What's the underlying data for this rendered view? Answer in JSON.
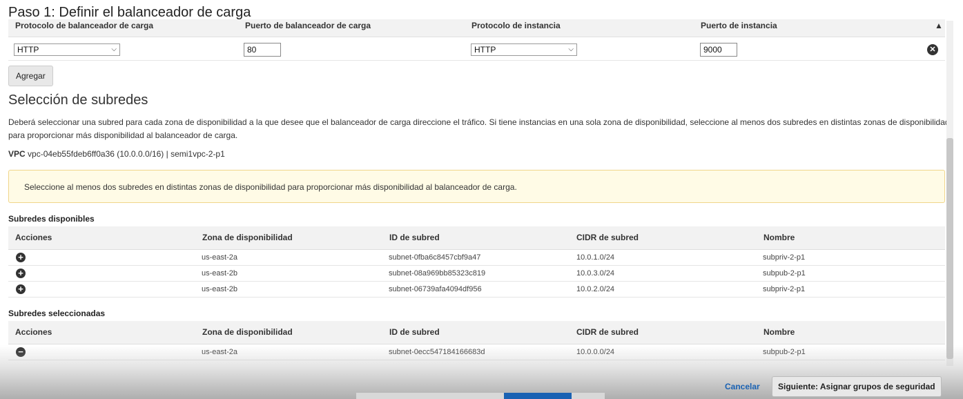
{
  "step_title": "Paso 1: Definir el balanceador de carga",
  "listeners": {
    "headers": [
      "Protocolo de balanceador de carga",
      "Puerto de balanceador de carga",
      "Protocolo de instancia",
      "Puerto de instancia"
    ],
    "row": {
      "lb_protocol": "HTTP",
      "lb_port": "80",
      "instance_protocol": "HTTP",
      "instance_port": "9000"
    },
    "add_label": "Agregar"
  },
  "subnets": {
    "title": "Selección de subredes",
    "description": "Deberá seleccionar una subred para cada zona de disponibilidad a la que desee que el balanceador de carga direccione el tráfico. Si tiene instancias en una sola zona de disponibilidad, seleccione al menos dos subredes en distintas zonas de disponibilidad para proporcionar más disponibilidad al balanceador de carga.",
    "vpc_label": "VPC",
    "vpc_value": "vpc-04eb55fdeb6ff0a36 (10.0.0.0/16) | semi1vpc-2-p1",
    "warning": "Seleccione al menos dos subredes en distintas zonas de disponibilidad para proporcionar más disponibilidad al balanceador de carga.",
    "available_label": "Subredes disponibles",
    "selected_label": "Subredes seleccionadas",
    "columns": [
      "Acciones",
      "Zona de disponibilidad",
      "ID de subred",
      "CIDR de subred",
      "Nombre"
    ],
    "available": [
      {
        "zone": "us-east-2a",
        "id": "subnet-0fba6c8457cbf9a47",
        "cidr": "10.0.1.0/24",
        "name": "subpriv-2-p1"
      },
      {
        "zone": "us-east-2b",
        "id": "subnet-08a969bb85323c819",
        "cidr": "10.0.3.0/24",
        "name": "subpub-2-p1"
      },
      {
        "zone": "us-east-2b",
        "id": "subnet-06739afa4094df956",
        "cidr": "10.0.2.0/24",
        "name": "subpriv-2-p1"
      }
    ],
    "selected": [
      {
        "zone": "us-east-2a",
        "id": "subnet-0ecc547184166683d",
        "cidr": "10.0.0.0/24",
        "name": "subpub-2-p1"
      }
    ]
  },
  "footer": {
    "cancel": "Cancelar",
    "next": "Siguiente: Asignar grupos de seguridad"
  },
  "icons": {
    "add": "plus-circle-icon",
    "remove": "minus-circle-icon",
    "delete": "close-circle-icon"
  },
  "colors": {
    "link": "#1a62b3",
    "warning_bg": "#fffbe6",
    "warning_border": "#f0d58a"
  }
}
